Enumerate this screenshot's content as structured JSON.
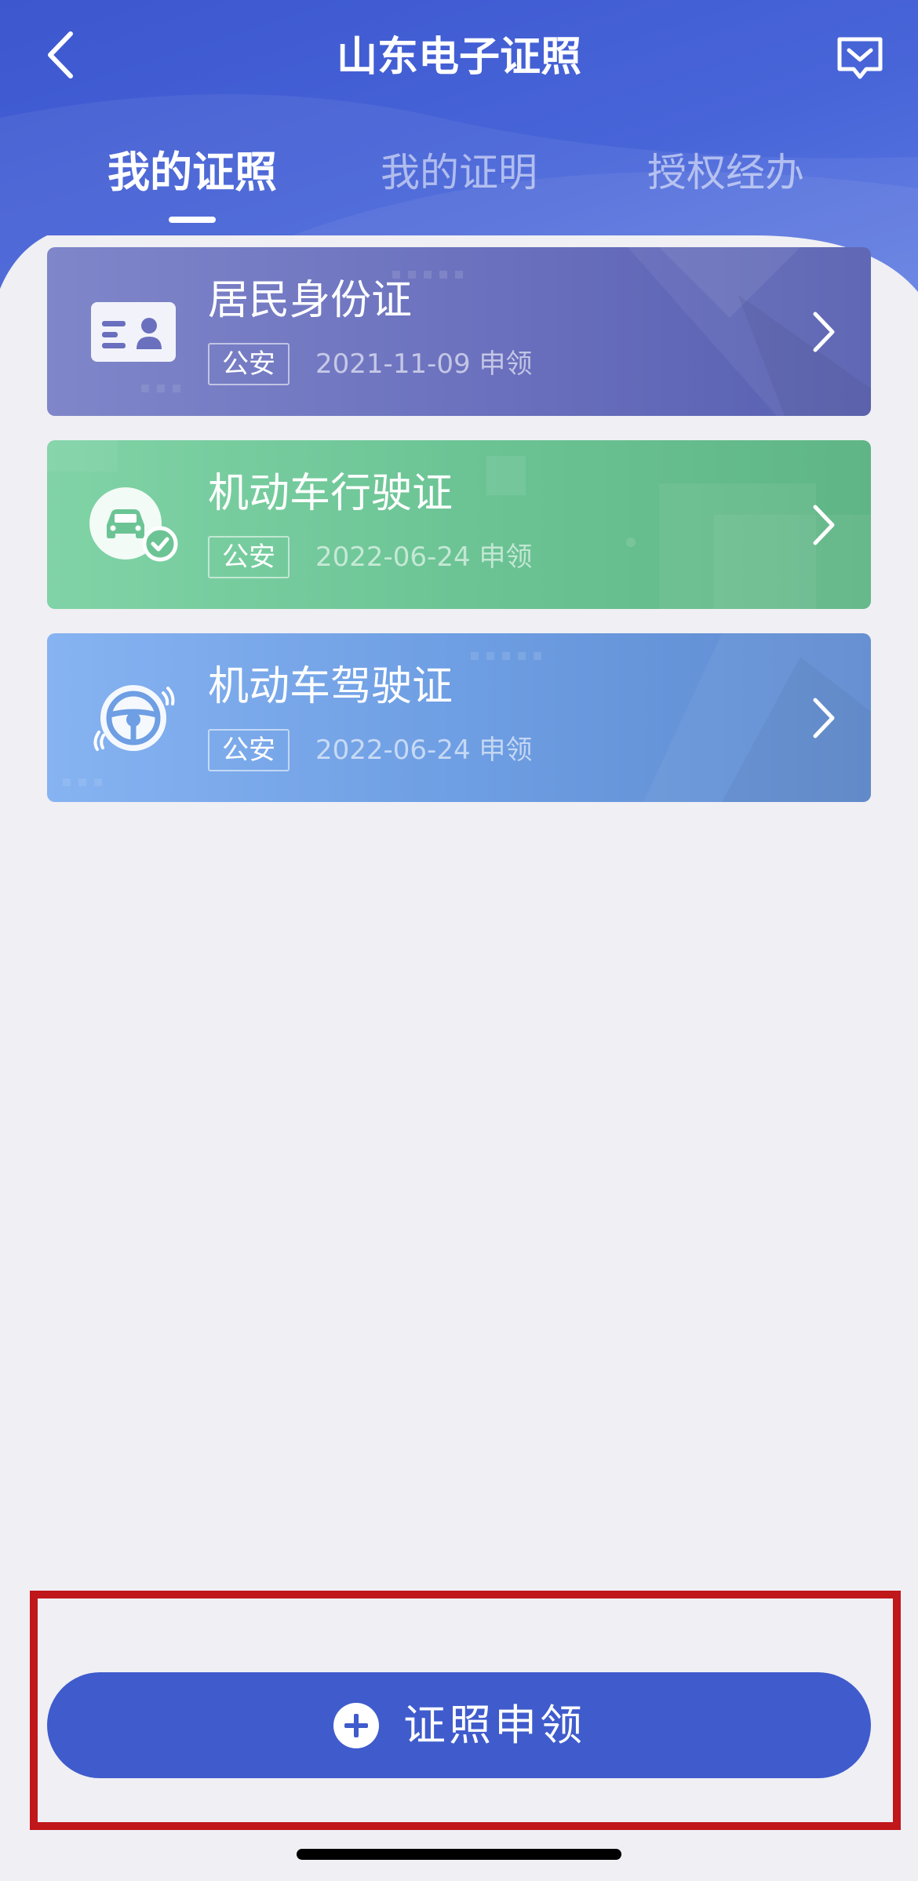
{
  "header": {
    "title": "山东电子证照",
    "back_icon": "chevron-left-icon",
    "message_icon": "message-box-icon"
  },
  "tabs": [
    {
      "label": "我的证照",
      "active": true
    },
    {
      "label": "我的证明",
      "active": false
    },
    {
      "label": "授权经办",
      "active": false
    }
  ],
  "licenses": [
    {
      "name": "居民身份证",
      "tag": "公安",
      "date": "2021-11-09 申领",
      "icon": "id-card-icon",
      "color": "#6a70bd"
    },
    {
      "name": "机动车行驶证",
      "tag": "公安",
      "date": "2022-06-24 申领",
      "icon": "car-check-icon",
      "color": "#6cc495"
    },
    {
      "name": "机动车驾驶证",
      "tag": "公安",
      "date": "2022-06-24 申领",
      "icon": "steering-wheel-icon",
      "color": "#6e9ee3"
    }
  ],
  "footer": {
    "apply_label": "证照申领",
    "apply_icon": "plus-circle-icon",
    "button_color": "#3f5bcc",
    "highlight_color": "#c0171b"
  },
  "colors": {
    "header_blue": "#4360d3",
    "page_bg": "#efeff4"
  }
}
